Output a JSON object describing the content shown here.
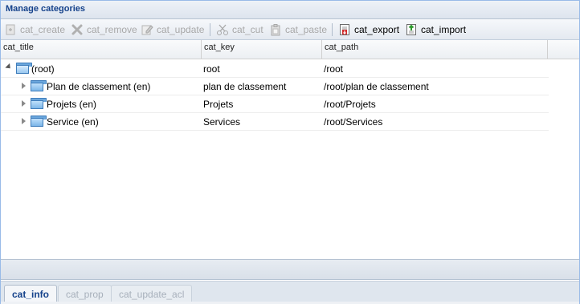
{
  "panel": {
    "title": "Manage categories"
  },
  "toolbar": {
    "buttons": [
      {
        "label": "cat_create",
        "icon": "create-icon",
        "enabled": false
      },
      {
        "label": "cat_remove",
        "icon": "remove-x-icon",
        "enabled": false
      },
      {
        "label": "cat_update",
        "icon": "edit-icon",
        "enabled": false
      },
      {
        "label": "cat_cut",
        "icon": "cut-scissors-icon",
        "enabled": false
      },
      {
        "label": "cat_paste",
        "icon": "paste-clipboard-icon",
        "enabled": false
      },
      {
        "label": "cat_export",
        "icon": "export-icon",
        "enabled": true
      },
      {
        "label": "cat_import",
        "icon": "import-icon",
        "enabled": true
      }
    ]
  },
  "grid": {
    "columns": [
      "cat_title",
      "cat_key",
      "cat_path"
    ],
    "rows": [
      {
        "title": "(root)",
        "key": "root",
        "path": "/root",
        "level": 0,
        "expanded": true
      },
      {
        "title": "Plan de classement (en)",
        "key": "plan de classement",
        "path": "/root/plan de classement",
        "level": 1,
        "expanded": false
      },
      {
        "title": "Projets (en)",
        "key": "Projets",
        "path": "/root/Projets",
        "level": 1,
        "expanded": false
      },
      {
        "title": "Service (en)",
        "key": "Services",
        "path": "/root/Services",
        "level": 1,
        "expanded": false
      }
    ]
  },
  "bottom_tabs": [
    {
      "label": "cat_info",
      "active": true
    },
    {
      "label": "cat_prop",
      "active": false
    },
    {
      "label": "cat_update_acl",
      "active": false
    }
  ],
  "colors": {
    "title_text": "#15428b",
    "border": "#99bbe8",
    "disabled_text": "#a8a8a8"
  }
}
